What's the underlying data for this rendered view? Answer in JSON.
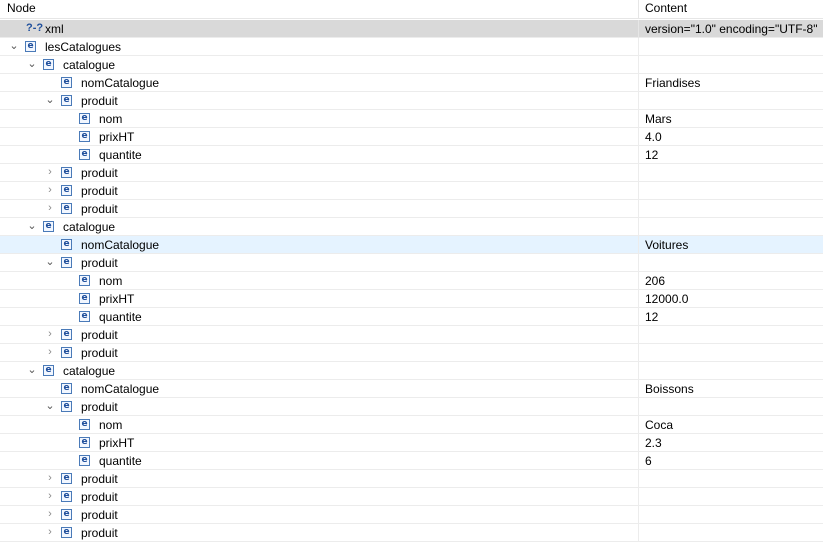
{
  "header": {
    "node": "Node",
    "content": "Content"
  },
  "pi": {
    "icon": "?-?",
    "name": "xml",
    "content": "version=\"1.0\" encoding=\"UTF-8\""
  },
  "icons": {
    "element": "e",
    "expanded": "⌄",
    "collapsed": "›"
  },
  "rows": [
    {
      "depth": 0,
      "twisty": "expanded",
      "label": "lesCatalogues",
      "content": ""
    },
    {
      "depth": 1,
      "twisty": "expanded",
      "label": "catalogue",
      "content": ""
    },
    {
      "depth": 2,
      "twisty": "none",
      "label": "nomCatalogue",
      "content": "Friandises"
    },
    {
      "depth": 2,
      "twisty": "expanded",
      "label": "produit",
      "content": ""
    },
    {
      "depth": 3,
      "twisty": "none",
      "label": "nom",
      "content": "Mars"
    },
    {
      "depth": 3,
      "twisty": "none",
      "label": "prixHT",
      "content": "4.0"
    },
    {
      "depth": 3,
      "twisty": "none",
      "label": "quantite",
      "content": "12"
    },
    {
      "depth": 2,
      "twisty": "collapsed",
      "label": "produit",
      "content": ""
    },
    {
      "depth": 2,
      "twisty": "collapsed",
      "label": "produit",
      "content": ""
    },
    {
      "depth": 2,
      "twisty": "collapsed",
      "label": "produit",
      "content": ""
    },
    {
      "depth": 1,
      "twisty": "expanded",
      "label": "catalogue",
      "content": ""
    },
    {
      "depth": 2,
      "twisty": "none",
      "label": "nomCatalogue",
      "content": "Voitures",
      "selected": true
    },
    {
      "depth": 2,
      "twisty": "expanded",
      "label": "produit",
      "content": ""
    },
    {
      "depth": 3,
      "twisty": "none",
      "label": "nom",
      "content": "206"
    },
    {
      "depth": 3,
      "twisty": "none",
      "label": "prixHT",
      "content": "12000.0"
    },
    {
      "depth": 3,
      "twisty": "none",
      "label": "quantite",
      "content": "12"
    },
    {
      "depth": 2,
      "twisty": "collapsed",
      "label": "produit",
      "content": ""
    },
    {
      "depth": 2,
      "twisty": "collapsed",
      "label": "produit",
      "content": ""
    },
    {
      "depth": 1,
      "twisty": "expanded",
      "label": "catalogue",
      "content": ""
    },
    {
      "depth": 2,
      "twisty": "none",
      "label": "nomCatalogue",
      "content": "Boissons"
    },
    {
      "depth": 2,
      "twisty": "expanded",
      "label": "produit",
      "content": ""
    },
    {
      "depth": 3,
      "twisty": "none",
      "label": "nom",
      "content": "Coca"
    },
    {
      "depth": 3,
      "twisty": "none",
      "label": "prixHT",
      "content": "2.3"
    },
    {
      "depth": 3,
      "twisty": "none",
      "label": "quantite",
      "content": "6"
    },
    {
      "depth": 2,
      "twisty": "collapsed",
      "label": "produit",
      "content": ""
    },
    {
      "depth": 2,
      "twisty": "collapsed",
      "label": "produit",
      "content": ""
    },
    {
      "depth": 2,
      "twisty": "collapsed",
      "label": "produit",
      "content": ""
    },
    {
      "depth": 2,
      "twisty": "collapsed",
      "label": "produit",
      "content": ""
    }
  ]
}
